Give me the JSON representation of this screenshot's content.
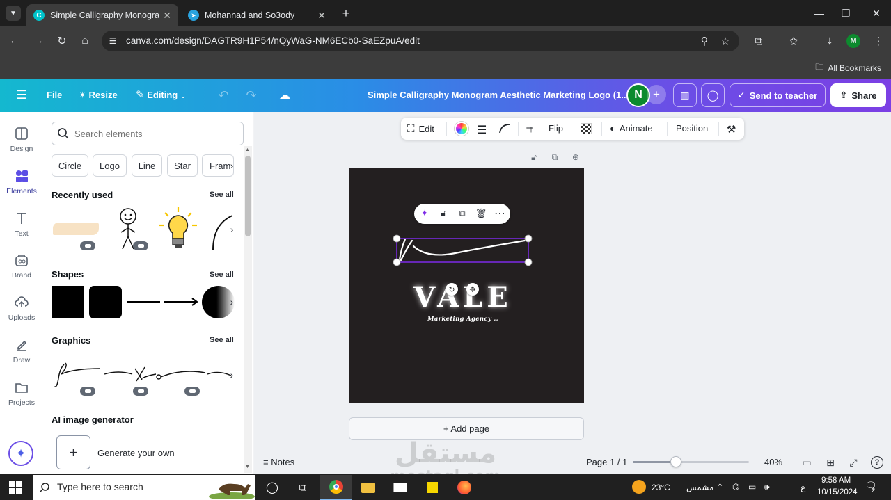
{
  "browser": {
    "tabs": [
      {
        "title": "Simple Calligraphy Monogram",
        "active": true
      },
      {
        "title": "Mohannad and So3ody",
        "active": false
      }
    ],
    "url": "canva.com/design/DAGTR9H1P54/nQyWaG-NM6ECb0-SaEZpuA/edit",
    "bookmarks_label": "All Bookmarks",
    "profile_initial": "M"
  },
  "header": {
    "file_label": "File",
    "resize_label": "Resize",
    "editing_label": "Editing",
    "doc_title": "Simple Calligraphy Monogram Aesthetic Marketing Logo (1...",
    "avatar_initial": "N",
    "send_label": "Send to teacher",
    "share_label": "Share"
  },
  "rail": [
    {
      "label": "Design",
      "icon": "design-icon"
    },
    {
      "label": "Elements",
      "icon": "elements-icon",
      "active": true
    },
    {
      "label": "Text",
      "icon": "text-icon"
    },
    {
      "label": "Brand",
      "icon": "brand-icon"
    },
    {
      "label": "Uploads",
      "icon": "uploads-icon"
    },
    {
      "label": "Draw",
      "icon": "draw-icon"
    },
    {
      "label": "Projects",
      "icon": "projects-icon"
    }
  ],
  "panel": {
    "search_placeholder": "Search elements",
    "chips": [
      "Circle",
      "Logo",
      "Line",
      "Star",
      "Fram"
    ],
    "recently_used": "Recently used",
    "shapes": "Shapes",
    "graphics": "Graphics",
    "see_all": "See all",
    "ai_title": "AI image generator",
    "generate_label": "Generate your own"
  },
  "context_toolbar": {
    "edit": "Edit",
    "flip": "Flip",
    "animate": "Animate",
    "position": "Position"
  },
  "design": {
    "brand": "VALE",
    "tagline": "Marketing Agency ..",
    "add_page": "+ Add page"
  },
  "footer": {
    "notes": "Notes",
    "page_indicator": "Page 1 / 1",
    "zoom": "40%",
    "zoom_fraction": 0.37
  },
  "watermark": {
    "arabic": "مستقل",
    "latin": "mostaql.com"
  },
  "taskbar": {
    "search_placeholder": "Type here to search",
    "weather": "23°C",
    "weather_text": "مشمس",
    "lang": "ع",
    "time": "9:58 AM",
    "date": "10/15/2024",
    "notifications": "2"
  },
  "colors": {
    "header_gradient_start": "#14b8cf",
    "header_gradient_end": "#7b3fe4",
    "design_bg": "#231f20",
    "selection": "#7d2ae8"
  }
}
